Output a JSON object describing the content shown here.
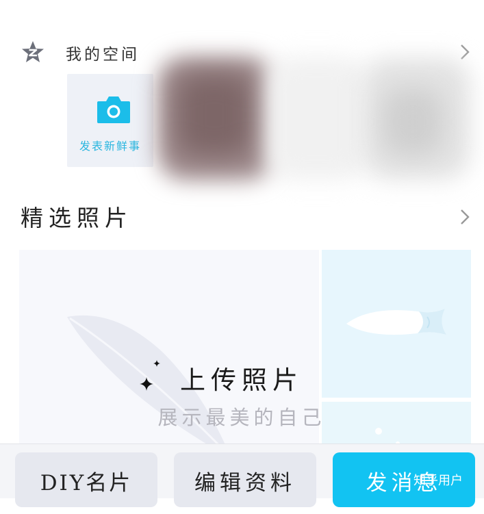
{
  "space": {
    "title": "我的空间",
    "post_label": "发表新鲜事"
  },
  "photos": {
    "title": "精选照片",
    "upload_title": "上传照片",
    "upload_subtitle": "展示最美的自己"
  },
  "bottom_bar": {
    "diy_label": "DIY名片",
    "edit_label": "编辑资料",
    "post_label": "发消息"
  },
  "watermark": "知乎用户",
  "colors": {
    "accent": "#12c3f2",
    "camera": "#1bbde9",
    "post_label": "#2bb6df"
  }
}
